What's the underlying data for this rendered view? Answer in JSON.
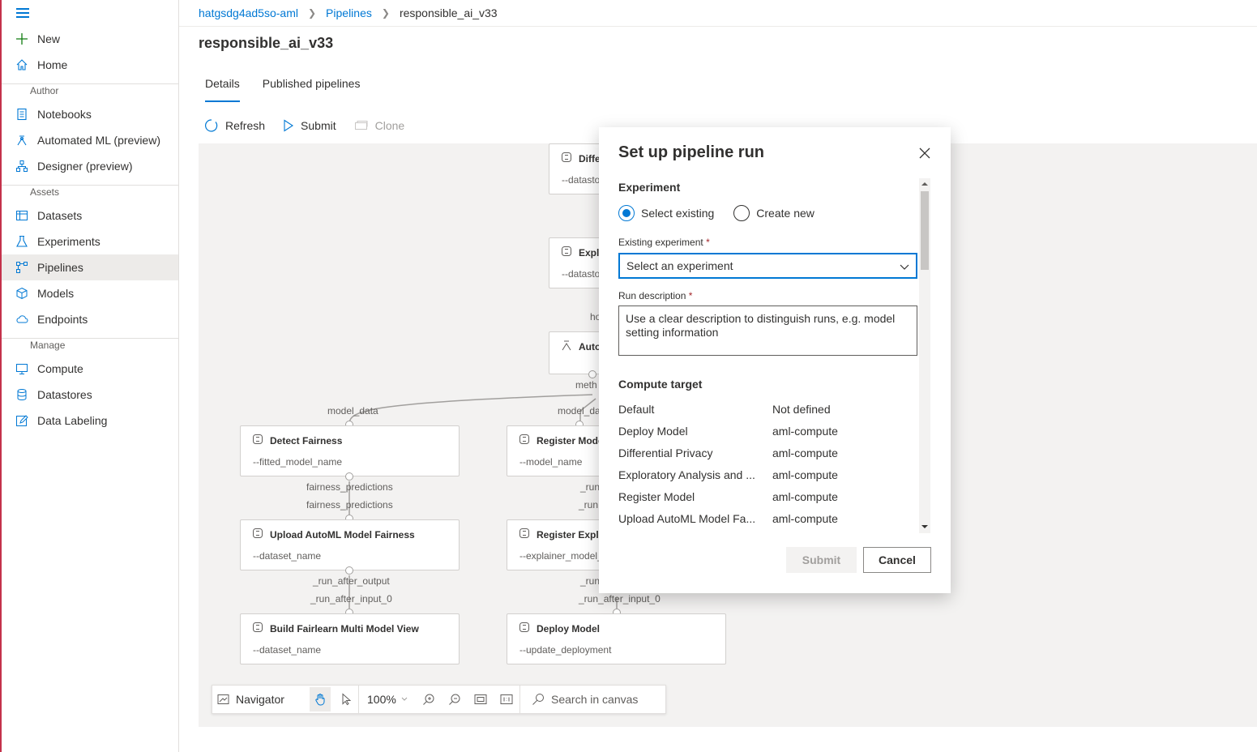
{
  "sidebar": {
    "items": [
      {
        "label": "New"
      },
      {
        "label": "Home"
      },
      {
        "label": "Notebooks"
      },
      {
        "label": "Automated ML (preview)"
      },
      {
        "label": "Designer (preview)"
      },
      {
        "label": "Datasets"
      },
      {
        "label": "Experiments"
      },
      {
        "label": "Pipelines"
      },
      {
        "label": "Models"
      },
      {
        "label": "Endpoints"
      },
      {
        "label": "Compute"
      },
      {
        "label": "Datastores"
      },
      {
        "label": "Data Labeling"
      }
    ],
    "sections": {
      "author": "Author",
      "assets": "Assets",
      "manage": "Manage"
    }
  },
  "breadcrumb": {
    "workspace": "hatgsdg4ad5so-aml",
    "pipelines": "Pipelines",
    "current": "responsible_ai_v33"
  },
  "page": {
    "title": "responsible_ai_v33"
  },
  "tabs": {
    "details": "Details",
    "published": "Published pipelines"
  },
  "toolbar": {
    "refresh": "Refresh",
    "submit": "Submit",
    "clone": "Clone"
  },
  "canvas": {
    "nodes": [
      {
        "title": "Diffe",
        "sub": "--datasto"
      },
      {
        "title": "Explo",
        "sub": "--datasto"
      },
      {
        "title": "Auto",
        "sub": ""
      },
      {
        "title": "Detect Fairness",
        "sub": "--fitted_model_name"
      },
      {
        "title": "Register Mode",
        "sub": "--model_name"
      },
      {
        "title": "Upload AutoML Model Fairness",
        "sub": "--dataset_name"
      },
      {
        "title": "Register Expla",
        "sub": "--explainer_model_"
      },
      {
        "title": "Build Fairlearn Multi Model View",
        "sub": "--dataset_name"
      },
      {
        "title": "Deploy Model",
        "sub": "--update_deployment"
      }
    ],
    "edge_labels": {
      "ho": "ho",
      "meth": "meth",
      "model_data_left": "model_data",
      "model_data_right": "model_da",
      "fp_out": "fairness_predictions",
      "fp_in": "fairness_predictions",
      "run_r1": "_run",
      "run_r2": "_run",
      "rao": "_run_after_output",
      "rai": "_run_after_input_0",
      "run_r3": "_run",
      "rai_r": "_run_after_input_0"
    },
    "bottom_toolbar": {
      "navigator": "Navigator",
      "zoom": "100%",
      "search_placeholder": "Search in canvas"
    }
  },
  "dialog": {
    "title": "Set up pipeline run",
    "experiment_label": "Experiment",
    "radio_existing": "Select existing",
    "radio_new": "Create new",
    "existing_label": "Existing experiment",
    "existing_placeholder": "Select an experiment",
    "desc_label": "Run description",
    "desc_placeholder": "Use a clear description to distinguish runs, e.g. model setting information",
    "compute_label": "Compute target",
    "compute_rows": [
      {
        "k": "Default",
        "v": "Not defined"
      },
      {
        "k": "Deploy Model",
        "v": "aml-compute"
      },
      {
        "k": "Differential Privacy",
        "v": "aml-compute"
      },
      {
        "k": "Exploratory Analysis and ...",
        "v": "aml-compute"
      },
      {
        "k": "Register Model",
        "v": "aml-compute"
      },
      {
        "k": "Upload AutoML Model Fa...",
        "v": "aml-compute"
      }
    ],
    "submit": "Submit",
    "cancel": "Cancel"
  }
}
